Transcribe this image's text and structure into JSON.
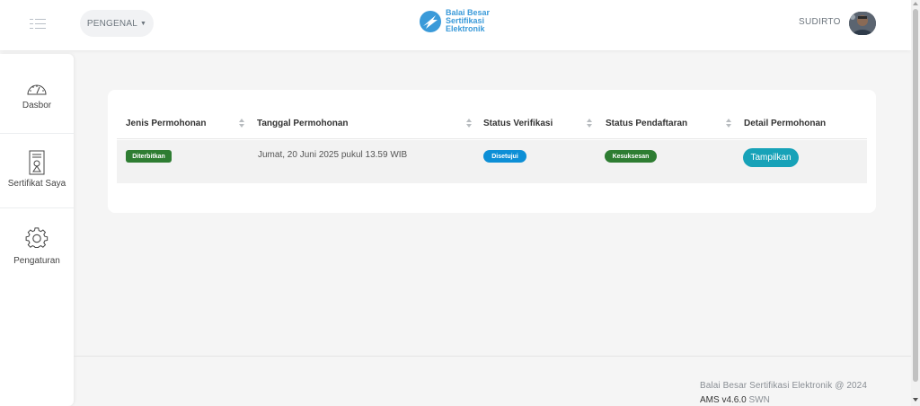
{
  "navbar": {
    "menu_icon": "hamburger-menu-icon",
    "dropdown_label": "PENGENAL",
    "logo_lines": [
      "Balai Besar",
      "Sertifikasi",
      "Elektronik"
    ],
    "user_name": "SUDIRTO"
  },
  "sidebar": {
    "items": [
      {
        "label": "Dasbor",
        "icon": "dashboard-gauge-icon"
      },
      {
        "label": "Sertifikat Saya",
        "icon": "certificate-icon"
      },
      {
        "label": "Pengaturan",
        "icon": "gear-icon"
      }
    ]
  },
  "table": {
    "columns": [
      "Jenis Permohonan",
      "Tanggal Permohonan",
      "Status Verifikasi",
      "Status Pendaftaran",
      "Detail Permohonan"
    ],
    "rows": [
      {
        "jenis": "Diterbitkan",
        "tanggal": "Jumat, 20 Juni 2025 pukul 13.59 WIB",
        "verifikasi": "Disetujui",
        "pendaftaran": "Kesuksesan",
        "detail_button": "Tampilkan"
      }
    ]
  },
  "footer": {
    "copyright": "Balai Besar Sertifikasi Elektronik @ 2024",
    "version": "AMS v4.6.0",
    "suffix": "SWN"
  },
  "colors": {
    "badge_green": "#2e7d32",
    "badge_blue": "#0d8fd6",
    "button_teal": "#17a2b8",
    "logo_blue": "#3a9ad9"
  }
}
